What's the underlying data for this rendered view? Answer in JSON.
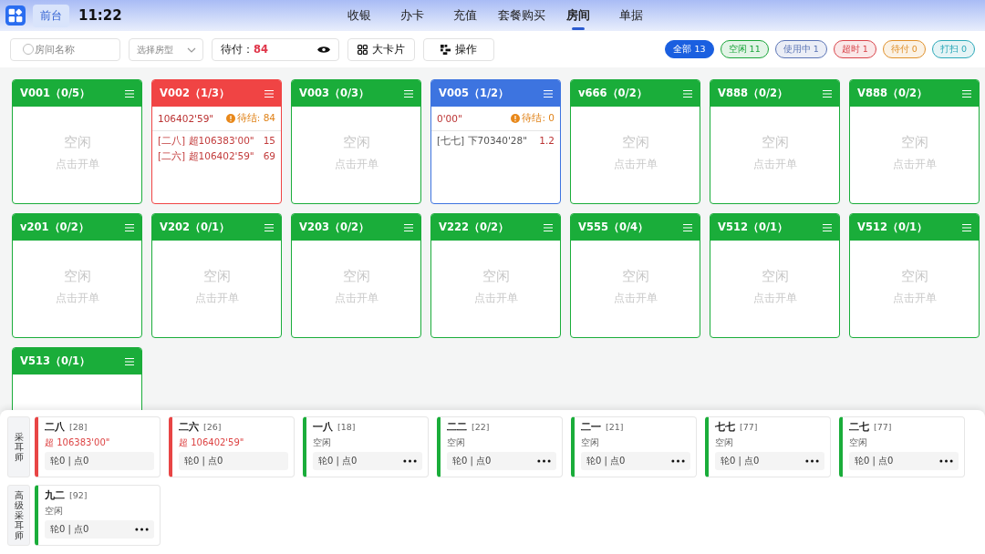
{
  "header": {
    "desk_tab": {
      "label": "前台",
      "selected": true
    },
    "time": "11:22",
    "nav": [
      {
        "label": "收银",
        "selected": false
      },
      {
        "label": "办卡",
        "selected": false
      },
      {
        "label": "充值",
        "selected": false
      },
      {
        "label": "套餐购买",
        "selected": false
      },
      {
        "label": "房间",
        "selected": true
      },
      {
        "label": "单据",
        "selected": false
      }
    ]
  },
  "toolbar": {
    "search": {
      "placeholder": "房间名称"
    },
    "room_type": {
      "placeholder": "选择房型"
    },
    "pending": {
      "label": "待付：",
      "value": "84"
    },
    "buttons": [
      {
        "label": "大卡片",
        "kind": "grid"
      },
      {
        "label": "操作",
        "kind": "ops"
      }
    ],
    "filters": [
      {
        "label": "全部",
        "count": "13",
        "color": "#1a5fe0",
        "selected": true
      },
      {
        "label": "空闲",
        "count": "11",
        "color": "#1aa53a",
        "selected": false
      },
      {
        "label": "使用中",
        "count": "1",
        "color": "#5a74b5",
        "selected": false
      },
      {
        "label": "超时",
        "count": "1",
        "color": "#d9444a",
        "selected": false
      },
      {
        "label": "待付",
        "count": "0",
        "color": "#e0902a",
        "selected": false
      },
      {
        "label": "打扫",
        "count": "0",
        "color": "#2aa8b8",
        "selected": false
      }
    ]
  },
  "rooms": [
    {
      "name": "V001（0/5）",
      "kind": "idle",
      "status": "空闲",
      "hint": "点击开单"
    },
    {
      "name": "V002（1/3）",
      "kind": "overtime",
      "time": "106402'59\"",
      "pending": "待结: 84",
      "lines": [
        {
          "text": "[二八] 超106383'00\"",
          "amount": "15"
        },
        {
          "text": "[二六] 超106402'59\"",
          "amount": "69"
        }
      ]
    },
    {
      "name": "V003（0/3）",
      "kind": "idle",
      "status": "空闲",
      "hint": "点击开单"
    },
    {
      "name": "V005（1/2）",
      "kind": "busy",
      "time": "0'00\"",
      "pending": "待结: 0",
      "lines": [
        {
          "text": "[七七] 下70340'28\"",
          "amount": "1.2"
        }
      ]
    },
    {
      "name": "v666（0/2）",
      "kind": "idle",
      "status": "空闲",
      "hint": "点击开单"
    },
    {
      "name": "V888（0/2）",
      "kind": "idle",
      "status": "空闲",
      "hint": "点击开单"
    },
    {
      "name": "V888（0/2）",
      "kind": "idle",
      "status": "空闲",
      "hint": "点击开单"
    },
    {
      "name": "v201（0/2）",
      "kind": "idle",
      "status": "空闲",
      "hint": "点击开单"
    },
    {
      "name": "V202（0/1）",
      "kind": "idle",
      "status": "空闲",
      "hint": "点击开单"
    },
    {
      "name": "V203（0/2）",
      "kind": "idle",
      "status": "空闲",
      "hint": "点击开单"
    },
    {
      "name": "V222（0/2）",
      "kind": "idle",
      "status": "空闲",
      "hint": "点击开单"
    },
    {
      "name": "V555（0/4）",
      "kind": "idle",
      "status": "空闲",
      "hint": "点击开单"
    },
    {
      "name": "V512（0/1）",
      "kind": "idle",
      "status": "空闲",
      "hint": "点击开单"
    },
    {
      "name": "V512（0/1）",
      "kind": "idle",
      "status": "空闲",
      "hint": "点击开单"
    },
    {
      "name": "V513（0/1）",
      "kind": "idle"
    }
  ],
  "staff_groups": [
    {
      "label": "采耳师",
      "staff": [
        {
          "name": "二八",
          "number": "[28]",
          "kind": "overtime",
          "status": "超 106383'00\"",
          "stats": "轮0 | 点0"
        },
        {
          "name": "二六",
          "number": "[26]",
          "kind": "overtime",
          "status": "超 106402'59\"",
          "stats": "轮0 | 点0"
        },
        {
          "name": "一八",
          "number": "[18]",
          "kind": "idle",
          "status": "空闲",
          "stats": "轮0 | 点0"
        },
        {
          "name": "二二",
          "number": "[22]",
          "kind": "idle",
          "status": "空闲",
          "stats": "轮0 | 点0"
        },
        {
          "name": "二一",
          "number": "[21]",
          "kind": "idle",
          "status": "空闲",
          "stats": "轮0 | 点0"
        },
        {
          "name": "七七",
          "number": "[77]",
          "kind": "idle",
          "status": "空闲",
          "stats": "轮0 | 点0"
        },
        {
          "name": "二七",
          "number": "[77]",
          "kind": "idle",
          "status": "空闲",
          "stats": "轮0 | 点0"
        }
      ]
    },
    {
      "label": "高级采耳师",
      "staff": [
        {
          "name": "九二",
          "number": "[92]",
          "kind": "idle",
          "status": "空闲",
          "stats": "轮0 | 点0"
        }
      ]
    }
  ]
}
